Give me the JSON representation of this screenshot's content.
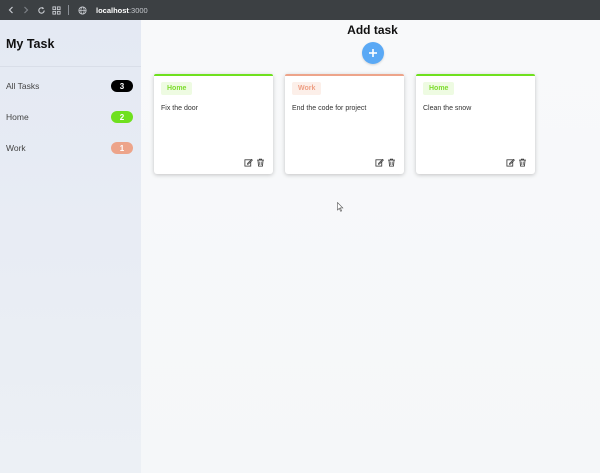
{
  "browser": {
    "url_host": "localhost",
    "url_port": ":3000"
  },
  "sidebar": {
    "title": "My Task",
    "items": [
      {
        "label": "All Tasks",
        "count": "3",
        "color": "#000000"
      },
      {
        "label": "Home",
        "count": "2",
        "color": "#6fe01e"
      },
      {
        "label": "Work",
        "count": "1",
        "color": "#eda48a"
      }
    ]
  },
  "main": {
    "title": "Add task",
    "add_button_symbol": "+"
  },
  "tasks": [
    {
      "tag": "Home",
      "text": "Fix the door",
      "accent": "#6fe01e",
      "tag_bg": "#eefbe2",
      "tag_color": "#7ddc2e"
    },
    {
      "tag": "Work",
      "text": "End the code for project",
      "accent": "#eda48a",
      "tag_bg": "#fcefe9",
      "tag_color": "#ee9f84"
    },
    {
      "tag": "Home",
      "text": "Clean the snow",
      "accent": "#6fe01e",
      "tag_bg": "#eefbe2",
      "tag_color": "#7ddc2e"
    }
  ],
  "icons": {
    "back": "arrow-left-icon",
    "forward": "arrow-right-icon",
    "reload": "reload-icon",
    "apps": "grid-icon",
    "site": "globe-icon",
    "edit": "edit-icon",
    "delete": "trash-icon",
    "add": "plus-icon"
  }
}
